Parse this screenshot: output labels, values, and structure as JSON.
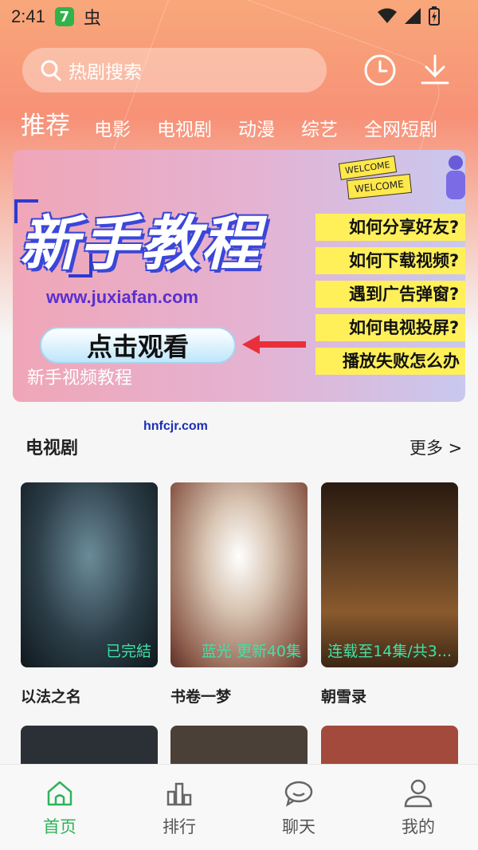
{
  "status_bar": {
    "time": "2:41",
    "app_badge": "7",
    "bug_glyph": "虫"
  },
  "header": {
    "search_placeholder": "热剧搜索",
    "tabs": [
      {
        "label": "推荐",
        "active": true
      },
      {
        "label": "电影",
        "active": false
      },
      {
        "label": "电视剧",
        "active": false
      },
      {
        "label": "动漫",
        "active": false
      },
      {
        "label": "综艺",
        "active": false
      },
      {
        "label": "全网短剧",
        "active": false
      }
    ]
  },
  "banner": {
    "title": "新手教程",
    "url": "www.juxiafan.com",
    "watch_button": "点击观看",
    "caption": "新手视频教程",
    "welcome_1": "WELCOME",
    "welcome_2": "WELCOME",
    "faq": [
      "如何分享好友?",
      "如何下载视频?",
      "遇到广告弹窗?",
      "如何电视投屏?",
      "播放失败怎么办"
    ]
  },
  "watermark": "hnfcjr.com",
  "section": {
    "title": "电视剧",
    "more": "更多 >",
    "items": [
      {
        "title": "以法之名",
        "status": "已完結"
      },
      {
        "title": "书卷一梦",
        "status": "蓝光 更新40集"
      },
      {
        "title": "朝雪录",
        "status": "连载至14集/共3..."
      }
    ]
  },
  "bottom_nav": [
    {
      "label": "首页",
      "icon": "home-icon",
      "active": true
    },
    {
      "label": "排行",
      "icon": "ranking-icon",
      "active": false
    },
    {
      "label": "聊天",
      "icon": "chat-icon",
      "active": false
    },
    {
      "label": "我的",
      "icon": "profile-icon",
      "active": false
    }
  ],
  "colors": {
    "accent": "#2fb35a",
    "header_gradient_top": "#f8a77a",
    "status_text": "#3de2a7"
  }
}
